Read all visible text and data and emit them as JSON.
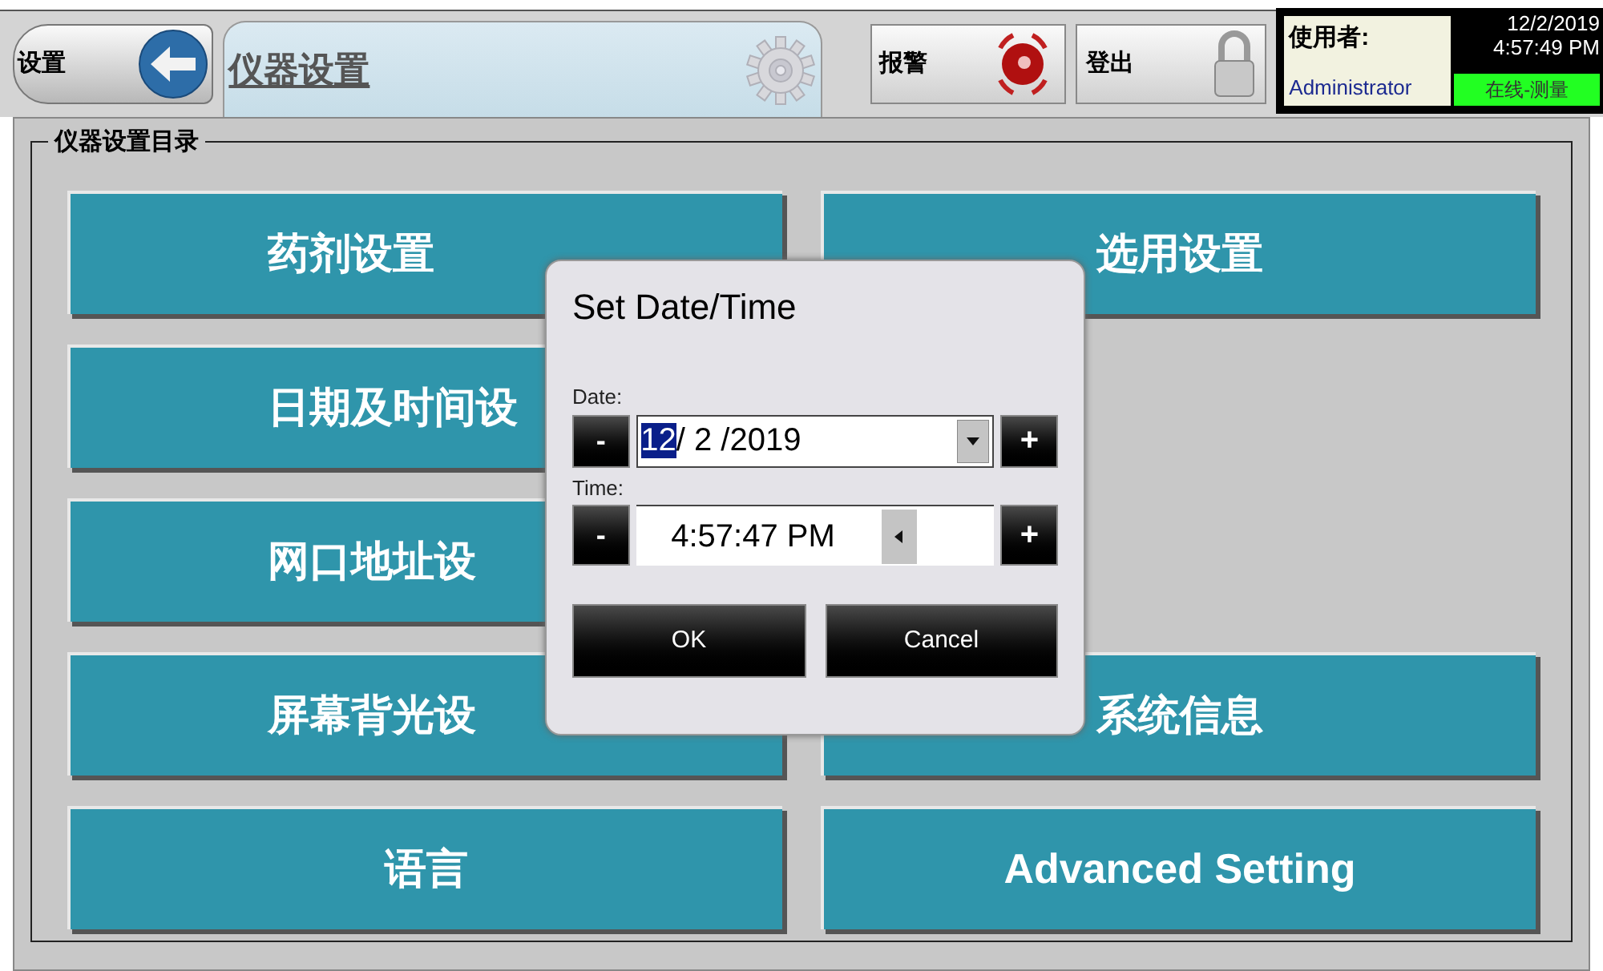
{
  "header": {
    "back_button": {
      "label": "设置"
    },
    "title_tab": {
      "label": "仪器设置"
    },
    "alarm_button": {
      "label": "报警"
    },
    "logout_button": {
      "label": "登出"
    },
    "user": {
      "label": "使用者:",
      "name": "Administrator"
    },
    "clock": {
      "date": "12/2/2019",
      "time": "4:57:49 PM"
    },
    "status": "在线-测量"
  },
  "group": {
    "title": "仪器设置目录",
    "rows": [
      {
        "left": "药剂设置",
        "right": "选用设置"
      },
      {
        "left": "日期及时间设"
      },
      {
        "left": "网口地址设"
      },
      {
        "left": "屏幕背光设",
        "right": "系统信息"
      },
      {
        "left": "语言",
        "right": "Advanced Setting"
      }
    ]
  },
  "dialog": {
    "title": "Set Date/Time",
    "date_label": "Date:",
    "date_selected": "12",
    "date_rest": "/ 2 /2019",
    "time_label": "Time:",
    "time_value": "4:57:47 PM",
    "minus": "-",
    "plus": "+",
    "buttons": [
      "OK",
      "Cancel"
    ]
  }
}
